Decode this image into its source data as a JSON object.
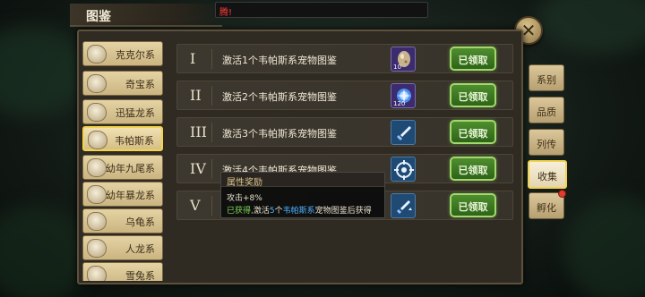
{
  "header": {
    "title": "图鉴",
    "notice": "腾!"
  },
  "categories": [
    {
      "label": "克克尔系",
      "active": false
    },
    {
      "label": "奇宝系",
      "active": false
    },
    {
      "label": "迅猛龙系",
      "active": false
    },
    {
      "label": "韦帕斯系",
      "active": true
    },
    {
      "label": "幼年九尾系",
      "active": false
    },
    {
      "label": "幼年暴龙系",
      "active": false
    },
    {
      "label": "乌龟系",
      "active": false
    },
    {
      "label": "人龙系",
      "active": false
    },
    {
      "label": "雪兔系",
      "active": false
    }
  ],
  "rows": [
    {
      "roman": "I",
      "text": "激活1个韦帕斯系宠物图鉴",
      "icon": "egg-icon",
      "count": "10",
      "claim": "已领取"
    },
    {
      "roman": "II",
      "text": "激活2个韦帕斯系宠物图鉴",
      "icon": "crystal-orb-icon",
      "count": "120",
      "claim": "已领取"
    },
    {
      "roman": "III",
      "text": "激活3个韦帕斯系宠物图鉴",
      "icon": "sword-icon",
      "count": "",
      "claim": "已领取"
    },
    {
      "roman": "IV",
      "text": "激活4个韦帕斯系宠物图鉴",
      "icon": "crosshair-icon",
      "count": "",
      "claim": "已领取"
    },
    {
      "roman": "V",
      "text": "",
      "icon": "sword-boost-icon",
      "count": "",
      "claim": "已领取"
    }
  ],
  "tabs": [
    {
      "label": "系别",
      "active": false,
      "dot": false
    },
    {
      "label": "品质",
      "active": false,
      "dot": false
    },
    {
      "label": "列传",
      "active": false,
      "dot": false
    },
    {
      "label": "收集",
      "active": true,
      "dot": false
    },
    {
      "label": "孵化",
      "active": false,
      "dot": true
    }
  ],
  "tooltip": {
    "title": "属性奖励",
    "stat": "攻击+8%",
    "desc_status": "已获得,",
    "desc_before": "激活",
    "desc_count": "5",
    "desc_middle": "个",
    "desc_series": "韦帕斯系",
    "desc_after": "宠物图鉴后获得"
  },
  "colors": {
    "accent_gold": "#f1d34d",
    "claim_green": "#4f8e2e",
    "alert_red": "#e03d2f"
  }
}
